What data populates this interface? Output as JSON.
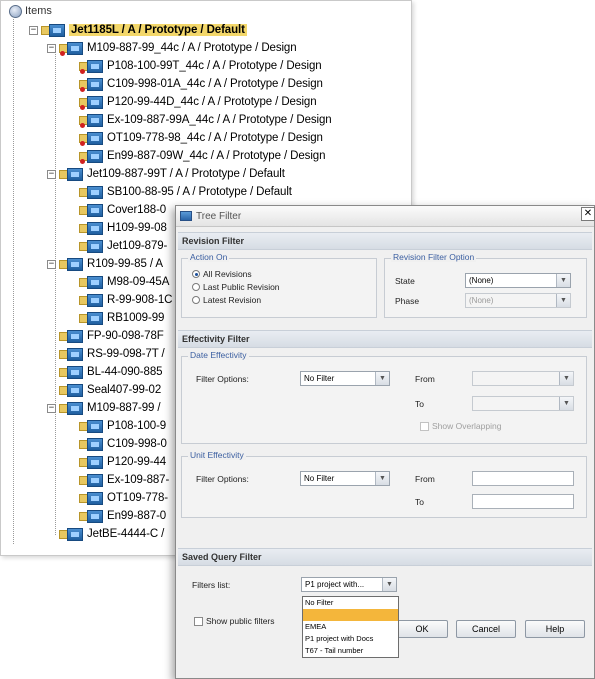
{
  "tree": {
    "root_label": "Items",
    "nodes": [
      {
        "label": "Jet1185L / A / Prototype / Default",
        "selected": true
      },
      {
        "label": "M109-887-99_44c / A / Prototype / Design"
      },
      {
        "label": "P108-100-99T_44c / A / Prototype / Design"
      },
      {
        "label": "C109-998-01A_44c / A / Prototype / Design"
      },
      {
        "label": "P120-99-44D_44c / A / Prototype / Design"
      },
      {
        "label": "Ex-109-887-99A_44c / A / Prototype / Design"
      },
      {
        "label": "OT109-778-98_44c / A / Prototype / Design"
      },
      {
        "label": "En99-887-09W_44c / A / Prototype / Design"
      },
      {
        "label": "Jet109-887-99T / A / Prototype / Default"
      },
      {
        "label": "SB100-88-95 / A / Prototype / Default"
      },
      {
        "label": "Cover188-0"
      },
      {
        "label": "H109-99-08"
      },
      {
        "label": "Jet109-879-"
      },
      {
        "label": "R109-99-85 / A"
      },
      {
        "label": "M98-09-45A"
      },
      {
        "label": "R-99-908-1C"
      },
      {
        "label": "RB1009-99"
      },
      {
        "label": "FP-90-098-78F"
      },
      {
        "label": "RS-99-098-7T /"
      },
      {
        "label": "BL-44-090-885"
      },
      {
        "label": "Seal407-99-02"
      },
      {
        "label": "M109-887-99 /"
      },
      {
        "label": "P108-100-9"
      },
      {
        "label": "C109-998-0"
      },
      {
        "label": "P120-99-44"
      },
      {
        "label": "Ex-109-887-"
      },
      {
        "label": "OT109-778-"
      },
      {
        "label": "En99-887-0"
      },
      {
        "label": "JetBE-4444-C /"
      }
    ]
  },
  "dialog": {
    "title": "Tree Filter",
    "close": "✕",
    "revision_filter": {
      "header": "Revision Filter",
      "action_on_title": "Action On",
      "radios": [
        {
          "label": "All Revisions",
          "checked": true
        },
        {
          "label": "Last Public Revision",
          "checked": false
        },
        {
          "label": "Latest Revision",
          "checked": false
        }
      ],
      "option_title": "Revision Filter Option",
      "state_label": "State",
      "state_value": "(None)",
      "phase_label": "Phase",
      "phase_value": "(None)"
    },
    "effectivity_filter": {
      "header": "Effectivity Filter",
      "date_title": "Date Effectivity",
      "date_filter_label": "Filter Options:",
      "date_filter_value": "No Filter",
      "from_label": "From",
      "to_label": "To",
      "show_overlapping": "Show Overlapping",
      "unit_title": "Unit Effectivity",
      "unit_filter_label": "Filter Options:",
      "unit_filter_value": "No Filter",
      "unit_from_label": "From",
      "unit_to_label": "To"
    },
    "saved_query": {
      "header": "Saved Query Filter",
      "filters_list_label": "Filters list:",
      "filters_list_value": "P1 project with...",
      "options": [
        "No Filter",
        "",
        "EMEA",
        "P1 project with Docs",
        "T67 - Tail number"
      ],
      "highlighted_index": 1,
      "show_public_filters": "Show public filters"
    },
    "buttons": {
      "ok": "OK",
      "cancel": "Cancel",
      "help": "Help"
    }
  }
}
